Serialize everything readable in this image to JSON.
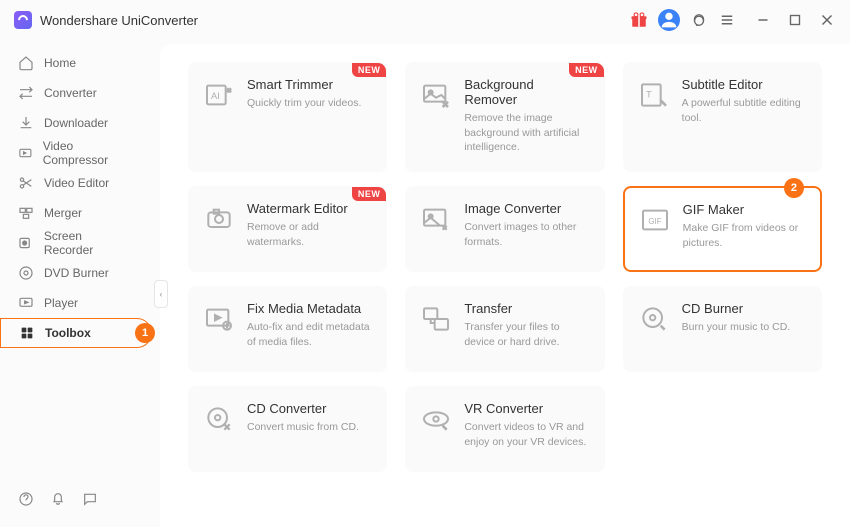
{
  "app": {
    "title": "Wondershare UniConverter"
  },
  "sidebar": {
    "items": [
      {
        "label": "Home"
      },
      {
        "label": "Converter"
      },
      {
        "label": "Downloader"
      },
      {
        "label": "Video Compressor"
      },
      {
        "label": "Video Editor"
      },
      {
        "label": "Merger"
      },
      {
        "label": "Screen Recorder"
      },
      {
        "label": "DVD Burner"
      },
      {
        "label": "Player"
      },
      {
        "label": "Toolbox"
      }
    ],
    "active_badge": "1"
  },
  "cards": [
    {
      "title": "Smart Trimmer",
      "desc": "Quickly trim your videos.",
      "new": true
    },
    {
      "title": "Background Remover",
      "desc": "Remove the image background with artificial intelligence.",
      "new": true
    },
    {
      "title": "Subtitle Editor",
      "desc": "A powerful subtitle editing tool."
    },
    {
      "title": "Watermark Editor",
      "desc": "Remove or add watermarks.",
      "new": true
    },
    {
      "title": "Image Converter",
      "desc": "Convert images to other formats."
    },
    {
      "title": "GIF Maker",
      "desc": "Make GIF from videos or pictures.",
      "highlighted": true,
      "badge": "2"
    },
    {
      "title": "Fix Media Metadata",
      "desc": "Auto-fix and edit metadata of media files."
    },
    {
      "title": "Transfer",
      "desc": "Transfer your files to device or hard drive."
    },
    {
      "title": "CD Burner",
      "desc": "Burn your music to CD."
    },
    {
      "title": "CD Converter",
      "desc": "Convert music from CD."
    },
    {
      "title": "VR Converter",
      "desc": "Convert videos to VR and enjoy on your VR devices."
    }
  ],
  "new_label": "NEW"
}
